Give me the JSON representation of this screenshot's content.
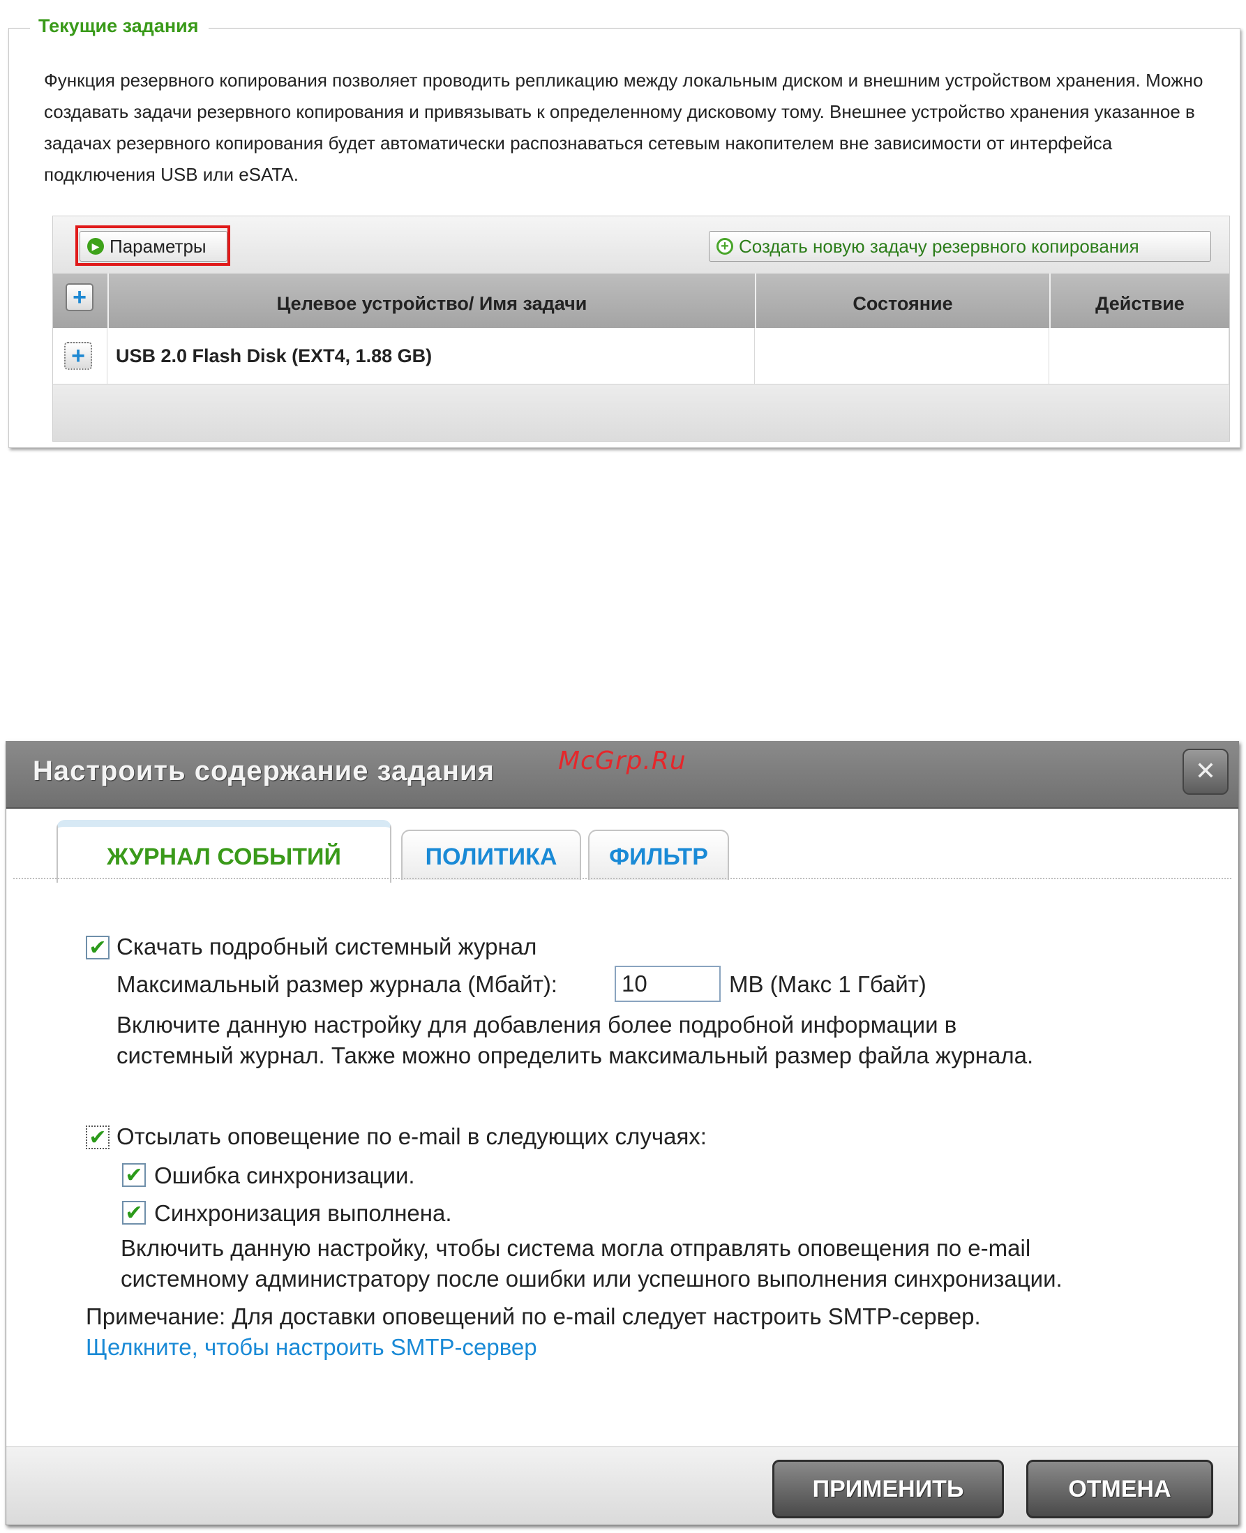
{
  "current_tasks": {
    "legend": "Текущие задания",
    "description": "Функция резервного копирования позволяет проводить репликацию между локальным диском и внешним устройством хранения. Можно создавать задачи резервного копирования и привязывать к определенному дисковому тому. Внешнее устройство хранения указанное в задачах резервного копирования будет автоматически распознаваться сетевым накопителем вне зависимости от интерфейса подключения USB или eSATA.",
    "params_button": "Параметры",
    "create_button": "Создать новую задачу резервного копирования",
    "columns": [
      "Целевое устройство/ Имя задачи",
      "Состояние",
      "Действие"
    ],
    "rows": [
      {
        "target": "USB 2.0 Flash Disk (EXT4, 1.88 GB)",
        "state": "",
        "action": ""
      }
    ]
  },
  "watermark": "McGrp.Ru",
  "dialog": {
    "title": "Настроить содержание задания",
    "close_symbol": "✕",
    "tabs": [
      "ЖУРНАЛ СОБЫТИЙ",
      "ПОЛИТИКА",
      "ФИЛЬТР"
    ],
    "download_log_label": "Скачать подробный системный журнал",
    "max_size_label": "Максимальный размер журнала (Мбайт):",
    "max_size_value": "10",
    "max_size_suffix": "MB (Макс 1 Гбайт)",
    "log_help_line1": "Включите данную настройку для добавления более подробной информации в",
    "log_help_line2": "системный журнал. Также можно определить максимальный размер файла журнала.",
    "email_label": "Отсылать оповещение по e-mail в следующих случаях:",
    "sync_error_label": "Ошибка синхронизации.",
    "sync_done_label": "Синхронизация выполнена.",
    "email_help_line1": "Включить данную настройку, чтобы система могла отправлять оповещения по e-mail",
    "email_help_line2": "системному администратору после ошибки или успешного выполнения синхронизации.",
    "note": "Примечание: Для доставки оповещений по e-mail следует настроить SMTP-сервер.",
    "smtp_link": "Щелкните, чтобы настроить SMTP-сервер",
    "apply": "ПРИМЕНИТЬ",
    "cancel": "ОТМЕНА",
    "checkbox_states": {
      "download_log": true,
      "email": true,
      "sync_error": true,
      "sync_done": true
    }
  },
  "colors": {
    "green_accent": "#3a9a1a",
    "link_blue": "#1a8ad6",
    "highlight_red": "#e01a1a"
  }
}
